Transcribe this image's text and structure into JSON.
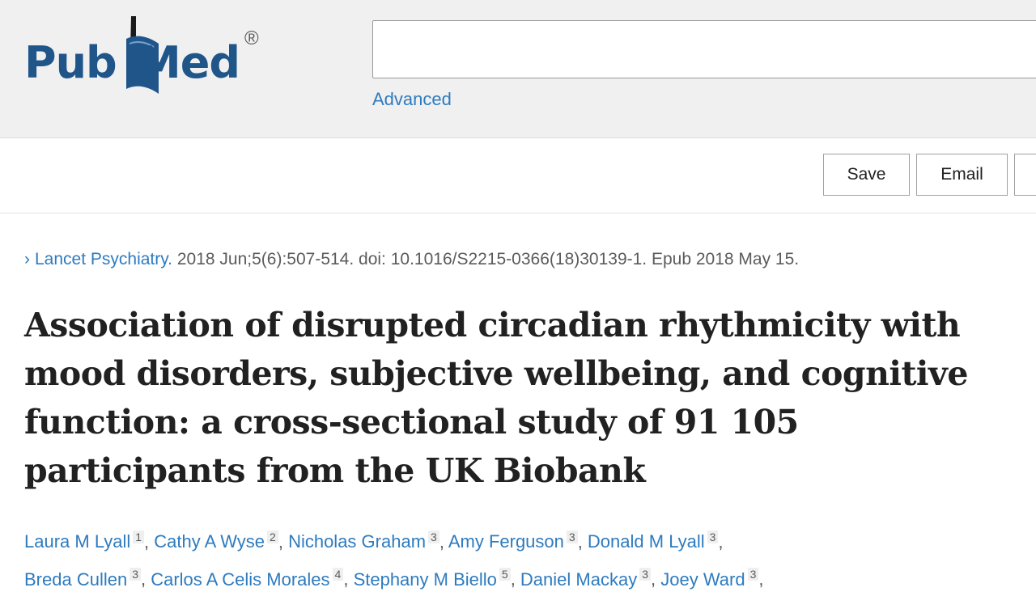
{
  "header": {
    "logo_pub": "Pub",
    "logo_med": "Med",
    "logo_reg": "®",
    "search_value": "",
    "advanced_label": "Advanced"
  },
  "actions": {
    "save_label": "Save",
    "email_label": "Email"
  },
  "article": {
    "journal": "Lancet Psychiatry.",
    "citation_rest": " 2018 Jun;5(6):507-514. doi: 10.1016/S2215-0366(18)30139-1. Epub 2018 May 15.",
    "title": "Association of disrupted circadian rhythmicity with mood disorders, subjective wellbeing, and cognitive function: a cross-sectional study of 91 105 participants from the UK Biobank",
    "authors": [
      {
        "name": "Laura M Lyall",
        "aff": "1"
      },
      {
        "name": "Cathy A Wyse",
        "aff": "2"
      },
      {
        "name": "Nicholas Graham",
        "aff": "3"
      },
      {
        "name": "Amy Ferguson",
        "aff": "3"
      },
      {
        "name": "Donald M Lyall",
        "aff": "3"
      },
      {
        "name": "Breda Cullen",
        "aff": "3"
      },
      {
        "name": "Carlos A Celis Morales",
        "aff": "4"
      },
      {
        "name": "Stephany M Biello",
        "aff": "5"
      },
      {
        "name": "Daniel Mackay",
        "aff": "3"
      },
      {
        "name": "Joey Ward",
        "aff": "3"
      }
    ]
  },
  "colors": {
    "brand": "#20558a",
    "link": "#2e7bbf",
    "header_bg": "#f0f0f0"
  },
  "icons": {
    "chevron": "chevron-right-icon",
    "logo_book": "pubmed-book-icon"
  }
}
